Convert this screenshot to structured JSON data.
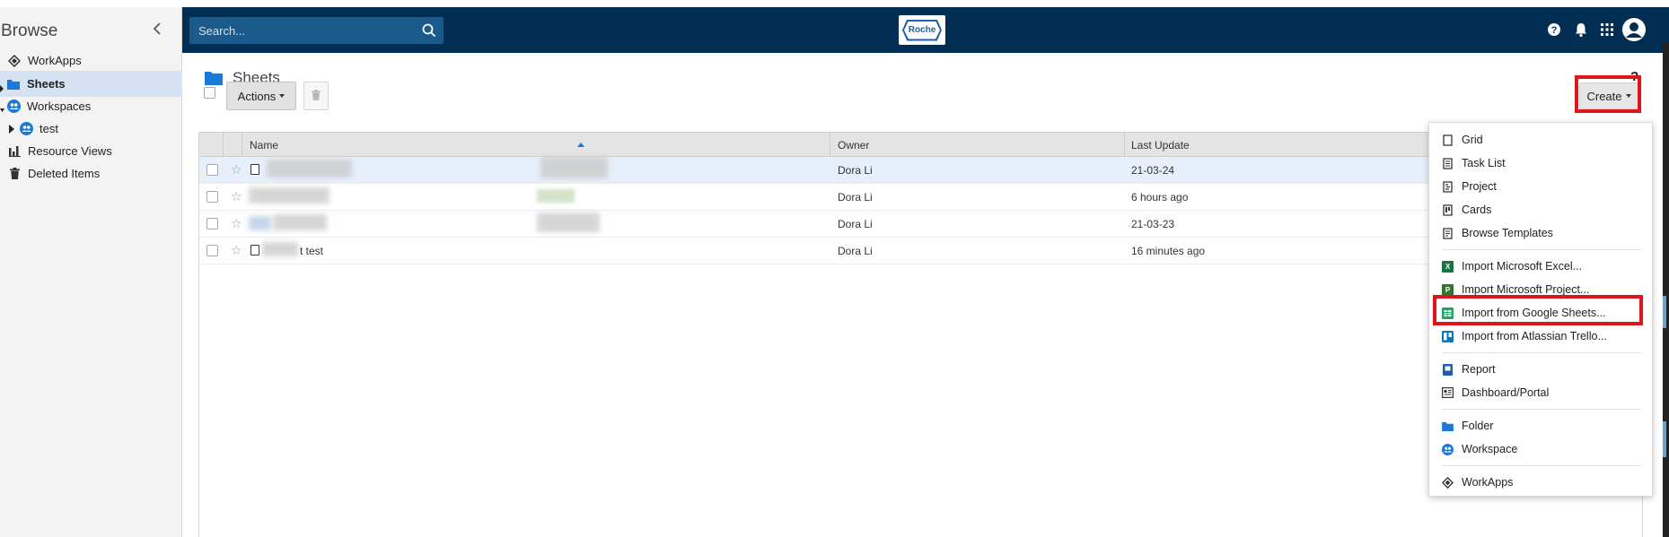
{
  "sidebar": {
    "title": "Browse",
    "items": [
      {
        "label": "WorkApps"
      },
      {
        "label": "Sheets"
      },
      {
        "label": "Workspaces"
      },
      {
        "label": "test"
      },
      {
        "label": "Resource Views"
      },
      {
        "label": "Deleted Items"
      }
    ]
  },
  "header": {
    "search_placeholder": "Search...",
    "logo_text": "Roche",
    "icons": [
      "help-icon",
      "notifications-bell-icon",
      "app-launcher-grid-icon",
      "user-avatar-icon"
    ]
  },
  "main": {
    "title": "Sheets",
    "help_label": "?",
    "actions_label": "Actions",
    "create_label": "Create"
  },
  "table": {
    "columns": [
      "Name",
      "Owner",
      "Last Update"
    ],
    "rows": [
      {
        "name": "",
        "owner": "Dora Li",
        "updated": "21-03-24"
      },
      {
        "name": "",
        "owner": "Dora Li",
        "updated": "6 hours ago"
      },
      {
        "name": "",
        "owner": "Dora Li",
        "updated": "21-03-23"
      },
      {
        "name": "t test",
        "owner": "Dora Li",
        "updated": "16 minutes ago"
      }
    ]
  },
  "create_menu": {
    "groups": [
      [
        {
          "label": "Grid",
          "icon": "grid-sheet-icon"
        },
        {
          "label": "Task List",
          "icon": "task-list-icon"
        },
        {
          "label": "Project",
          "icon": "project-icon"
        },
        {
          "label": "Cards",
          "icon": "cards-icon"
        },
        {
          "label": "Browse Templates",
          "icon": "templates-icon"
        }
      ],
      [
        {
          "label": "Import Microsoft Excel...",
          "icon": "excel-icon"
        },
        {
          "label": "Import Microsoft Project...",
          "icon": "ms-project-icon"
        },
        {
          "label": "Import from Google Sheets...",
          "icon": "google-sheets-icon"
        },
        {
          "label": "Import from Atlassian Trello...",
          "icon": "trello-icon"
        }
      ],
      [
        {
          "label": "Report",
          "icon": "report-icon"
        },
        {
          "label": "Dashboard/Portal",
          "icon": "dashboard-icon"
        }
      ],
      [
        {
          "label": "Folder",
          "icon": "folder-icon"
        },
        {
          "label": "Workspace",
          "icon": "workspace-icon"
        }
      ],
      [
        {
          "label": "WorkApps",
          "icon": "workapps-icon"
        }
      ]
    ]
  },
  "colors": {
    "header_bg": "#032e54",
    "search_bg": "#1a5b8c",
    "accent_blue": "#1a73e8",
    "highlight_red": "#e0141d",
    "selected_row": "#e6effa"
  }
}
